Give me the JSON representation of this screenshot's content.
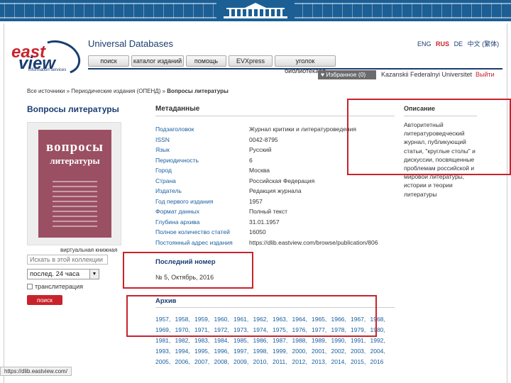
{
  "header": {
    "site_title": "Universal Databases",
    "logo_word1": "east",
    "logo_word2": "view",
    "logo_tagline": "information services",
    "languages": [
      "ENG",
      "RUS",
      "DE",
      "中文 (繁体)"
    ],
    "active_language": "RUS"
  },
  "nav": [
    "поиск",
    "каталог изданий",
    "помощь",
    "EVXpress",
    "уголок библиотекаря"
  ],
  "userbar": {
    "favorites": "Избранное (0)",
    "organization": "Kazanskii Federalnyi Universitet",
    "logout": "Выйти"
  },
  "breadcrumb": {
    "prefix": "Все источники » Периодические издания (ОПЕНД) » ",
    "current": "Вопросы литературы"
  },
  "journal_title": "Вопросы литературы",
  "cover": {
    "title_line1": "вопросы",
    "title_line2": "литературы",
    "bg_color": "#9b4f63"
  },
  "sidebar": {
    "virtual_shelf": "виртуальная книжная",
    "search_placeholder": "Искать в этой коллекции",
    "period": "послед. 24 часа",
    "transliteration": "транслитерация",
    "search_button": "поиск"
  },
  "metadata": {
    "heading": "Метаданные",
    "rows": [
      {
        "key": "Подзаголовок",
        "value": "Журнал критики и литературоведения"
      },
      {
        "key": "ISSN",
        "value": "0042-8795"
      },
      {
        "key": "Язык",
        "value": "Русский"
      },
      {
        "key": "Периодичность",
        "value": "6"
      },
      {
        "key": "Город",
        "value": "Москва"
      },
      {
        "key": "Страна",
        "value": "Российская Федерация"
      },
      {
        "key": "Издатель",
        "value": "Редакция журнала"
      },
      {
        "key": "Год первого издания",
        "value": "1957"
      },
      {
        "key": "Формат данных",
        "value": "Полный текст"
      },
      {
        "key": "Глубина архива",
        "value": "31.01.1957"
      },
      {
        "key": "Полное количество статей",
        "value": "16050"
      },
      {
        "key": "Постоянный адрес издания",
        "value": "https://dlib.eastview.com/browse/publication/806"
      }
    ]
  },
  "description": {
    "heading": "Описание",
    "text": "Авторитетный литературоведческий журнал, публикующий статьи, \"круглые столы\" и дискуссии, посвященные проблемам российской и мировой литературы, истории и теории литературы"
  },
  "latest_issue": {
    "heading": "Последний номер",
    "value": "№ 5, Октябрь, 2016"
  },
  "archive": {
    "heading": "Архив",
    "years": [
      "1957,",
      "1958,",
      "1959,",
      "1960,",
      "1961,",
      "1962,",
      "1963,",
      "1964,",
      "1965,",
      "1966,",
      "1967,",
      "1968,",
      "1969,",
      "1970,",
      "1971,",
      "1972,",
      "1973,",
      "1974,",
      "1975,",
      "1976,",
      "1977,",
      "1978,",
      "1979,",
      "1980,",
      "1981,",
      "1982,",
      "1983,",
      "1984,",
      "1985,",
      "1986,",
      "1987,",
      "1988,",
      "1989,",
      "1990,",
      "1991,",
      "1992,",
      "1993,",
      "1994,",
      "1995,",
      "1996,",
      "1997,",
      "1998,",
      "1999,",
      "2000,",
      "2001,",
      "2002,",
      "2003,",
      "2004,",
      "2005,",
      "2006,",
      "2007,",
      "2008,",
      "2009,",
      "2010,",
      "2011,",
      "2012,",
      "2013,",
      "2014,",
      "2015,",
      "2016"
    ]
  },
  "status_url": "https://dlib.eastview.com/",
  "colors": {
    "brand_red": "#c8232c",
    "brand_blue": "#1a3d72",
    "highlight_box": "#c8232c"
  }
}
